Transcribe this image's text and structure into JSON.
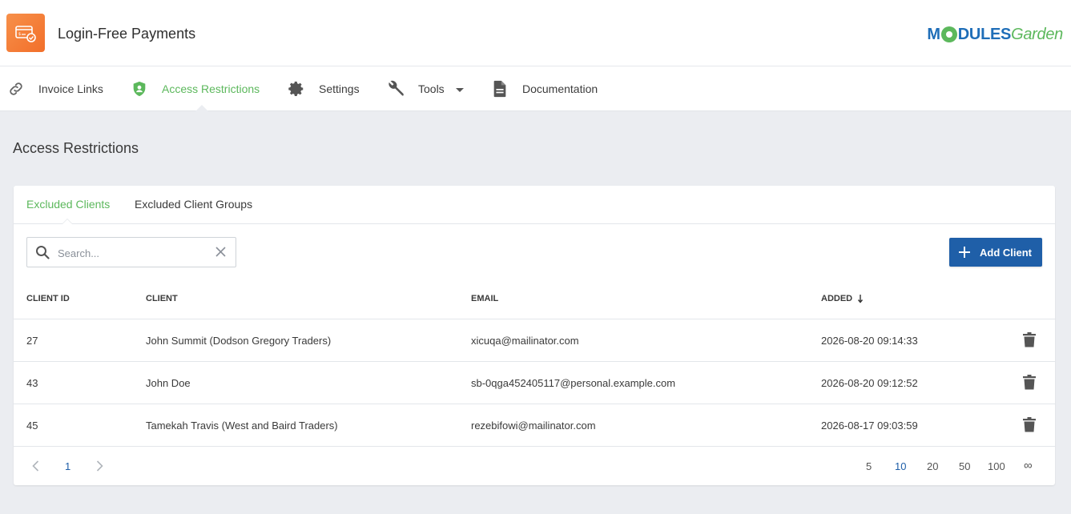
{
  "header": {
    "app_title": "Login-Free Payments",
    "brand_part1": "M",
    "brand_part2": "DULES",
    "brand_part3": "Garden"
  },
  "nav": {
    "items": [
      {
        "label": "Invoice Links",
        "icon": "link-icon"
      },
      {
        "label": "Access Restrictions",
        "icon": "shield-icon",
        "active": true
      },
      {
        "label": "Settings",
        "icon": "gear-icon"
      },
      {
        "label": "Tools",
        "icon": "wrench-icon",
        "has_dropdown": true
      },
      {
        "label": "Documentation",
        "icon": "document-icon"
      }
    ]
  },
  "page": {
    "title": "Access Restrictions"
  },
  "tabs": [
    {
      "label": "Excluded Clients",
      "active": true
    },
    {
      "label": "Excluded Client Groups"
    }
  ],
  "search": {
    "placeholder": "Search...",
    "value": ""
  },
  "toolbar": {
    "add_label": "Add Client"
  },
  "table": {
    "columns": [
      "Client ID",
      "Client",
      "Email",
      "Added"
    ],
    "sort_column": "Added",
    "sort_direction": "desc",
    "rows": [
      {
        "id": "27",
        "client": "John Summit (Dodson Gregory Traders)",
        "email": "xicuqa@mailinator.com",
        "added": "2026-08-20 09:14:33"
      },
      {
        "id": "43",
        "client": "John Doe",
        "email": "sb-0qga452405117@personal.example.com",
        "added": "2026-08-20 09:12:52"
      },
      {
        "id": "45",
        "client": "Tamekah Travis (West and Baird Traders)",
        "email": "rezebifowi@mailinator.com",
        "added": "2026-08-17 09:03:59"
      }
    ]
  },
  "pagination": {
    "current_page": "1",
    "per_page_options": [
      "5",
      "10",
      "20",
      "50",
      "100",
      "∞"
    ],
    "per_page_selected": "10"
  },
  "colors": {
    "accent_green": "#5cb85c",
    "primary_blue": "#1f5fa8",
    "app_orange": "#f47c38",
    "background": "#ebedf1"
  }
}
